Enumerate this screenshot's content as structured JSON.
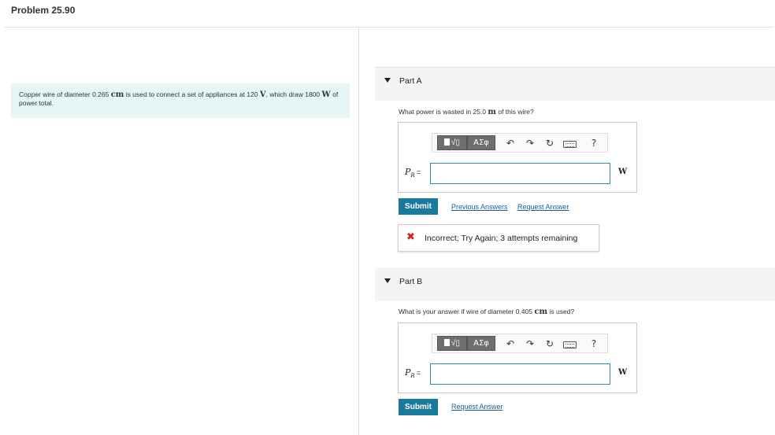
{
  "page": {
    "title": "Problem 25.90"
  },
  "problem": {
    "text_part1": "Copper wire of diameter 0.265 ",
    "unit_cm": "cm",
    "text_part2": " is used to connect a set of appliances at 120 ",
    "unit_V": "V",
    "text_part3": ", which draw 1800 ",
    "unit_W": "W",
    "text_part4": " of power total."
  },
  "toolbar": {
    "template_label": "√▯",
    "greek_label": "ΑΣφ",
    "undo_icon": "undo-icon",
    "redo_icon": "redo-icon",
    "reset_icon": "reset-icon",
    "keyboard_icon": "keyboard-icon",
    "help_label": "?"
  },
  "partA": {
    "label": "Part A",
    "question_part1": "What power is wasted in 25.0 ",
    "question_unit": "m",
    "question_part2": " of this wire?",
    "var_main": "P",
    "var_sub": "R",
    "equals": "=",
    "input_value": "",
    "unit": "W",
    "submit_label": "Submit",
    "previous_answers_label": "Previous Answers",
    "request_answer_label": "Request Answer",
    "feedback_icon": "✖",
    "feedback_text": "Incorrect; Try Again; 3 attempts remaining"
  },
  "partB": {
    "label": "Part B",
    "question_part1": "What is your answer if wire of diameter 0.405 ",
    "question_unit": "cm",
    "question_part2": " is used?",
    "var_main": "P",
    "var_sub": "R",
    "equals": "=",
    "input_value": "",
    "unit": "W",
    "submit_label": "Submit",
    "request_answer_label": "Request Answer"
  },
  "colors": {
    "accent": "#1a7a9c",
    "link": "#1a5f96",
    "intro_bg": "#e6f5f6",
    "error": "#d4231f"
  }
}
